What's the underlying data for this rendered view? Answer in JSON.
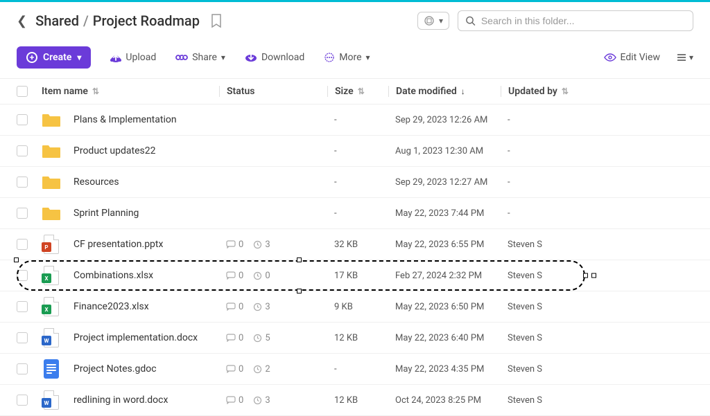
{
  "breadcrumb": {
    "root": "Shared",
    "current": "Project Roadmap"
  },
  "search": {
    "placeholder": "Search in this folder..."
  },
  "toolbar": {
    "create": "Create",
    "upload": "Upload",
    "share": "Share",
    "download": "Download",
    "more": "More",
    "edit_view": "Edit View"
  },
  "columns": {
    "name": "Item name",
    "status": "Status",
    "size": "Size",
    "date": "Date modified",
    "updated": "Updated by"
  },
  "rows": [
    {
      "type": "folder",
      "name": "Plans & Implementation",
      "comments": null,
      "history": null,
      "size": "-",
      "date": "Sep 29, 2023 12:26 AM",
      "updated": "-"
    },
    {
      "type": "folder",
      "name": "Product updates22",
      "comments": null,
      "history": null,
      "size": "-",
      "date": "Aug 1, 2023 12:30 AM",
      "updated": "-"
    },
    {
      "type": "folder",
      "name": "Resources",
      "comments": null,
      "history": null,
      "size": "-",
      "date": "Sep 29, 2023 12:27 AM",
      "updated": "-"
    },
    {
      "type": "folder",
      "name": "Sprint Planning",
      "comments": null,
      "history": null,
      "size": "-",
      "date": "May 22, 2023 7:44 PM",
      "updated": "-"
    },
    {
      "type": "pptx",
      "name": "CF presentation.pptx",
      "comments": "0",
      "history": "3",
      "size": "32 KB",
      "date": "May 22, 2023 6:55 PM",
      "updated": "Steven S"
    },
    {
      "type": "xlsx",
      "name": "Combinations.xlsx",
      "comments": "0",
      "history": "0",
      "size": "17 KB",
      "date": "Feb 27, 2024 2:32 PM",
      "updated": "Steven S",
      "highlighted": true
    },
    {
      "type": "xlsx",
      "name": "Finance2023.xlsx",
      "comments": "0",
      "history": "3",
      "size": "9 KB",
      "date": "May 22, 2023 6:50 PM",
      "updated": "Steven S"
    },
    {
      "type": "docx",
      "name": "Project implementation.docx",
      "comments": "0",
      "history": "5",
      "size": "12 KB",
      "date": "May 22, 2023 6:40 PM",
      "updated": "Steven S"
    },
    {
      "type": "gdoc",
      "name": "Project Notes.gdoc",
      "comments": "0",
      "history": "2",
      "size": "-",
      "date": "May 22, 2023 4:35 PM",
      "updated": "Steven S"
    },
    {
      "type": "docx",
      "name": "redlining in word.docx",
      "comments": "0",
      "history": "3",
      "size": "12 KB",
      "date": "Oct 24, 2023 8:25 PM",
      "updated": "Steven S"
    }
  ]
}
